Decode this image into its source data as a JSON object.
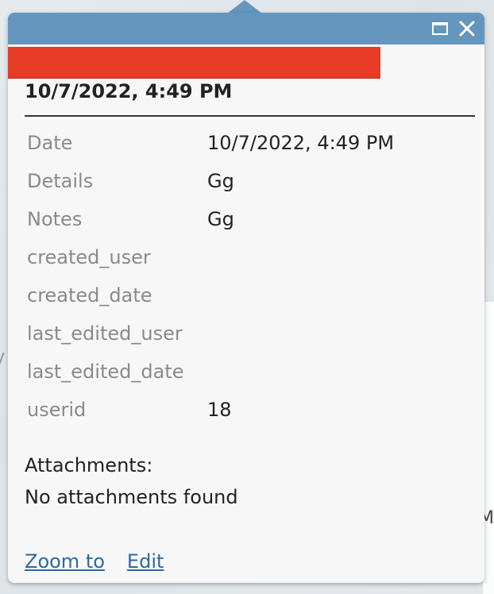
{
  "popup": {
    "title": "10/7/2022, 4:49 PM",
    "attributes": [
      {
        "name": "Date",
        "value": "10/7/2022, 4:49 PM"
      },
      {
        "name": "Details",
        "value": "Gg"
      },
      {
        "name": "Notes",
        "value": "Gg"
      },
      {
        "name": "created_user",
        "value": ""
      },
      {
        "name": "created_date",
        "value": ""
      },
      {
        "name": "last_edited_user",
        "value": ""
      },
      {
        "name": "last_edited_date",
        "value": ""
      },
      {
        "name": "userid",
        "value": "18"
      }
    ],
    "attachments_label": "Attachments:",
    "attachments_status": "No attachments found",
    "actions": {
      "zoom_label": "Zoom to",
      "edit_label": "Edit"
    }
  },
  "map": {
    "right_edge_text": "M"
  },
  "colors": {
    "header": "#6596bd",
    "redaction": "#e83b25",
    "link": "#2d6aa0"
  },
  "icons": {
    "maximize": "maximize-icon",
    "close": "close-icon"
  }
}
